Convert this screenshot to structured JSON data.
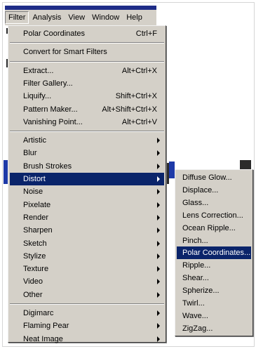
{
  "menubar": {
    "items": [
      "Filter",
      "Analysis",
      "View",
      "Window",
      "Help"
    ]
  },
  "filter_menu": {
    "groups": [
      [
        {
          "label": "Polar Coordinates",
          "shortcut": "Ctrl+F"
        }
      ],
      [
        {
          "label": "Convert for Smart Filters"
        }
      ],
      [
        {
          "label": "Extract...",
          "shortcut": "Alt+Ctrl+X"
        },
        {
          "label": "Filter Gallery..."
        },
        {
          "label": "Liquify...",
          "shortcut": "Shift+Ctrl+X"
        },
        {
          "label": "Pattern Maker...",
          "shortcut": "Alt+Shift+Ctrl+X"
        },
        {
          "label": "Vanishing Point...",
          "shortcut": "Alt+Ctrl+V"
        }
      ],
      [
        {
          "label": "Artistic",
          "submenu": true
        },
        {
          "label": "Blur",
          "submenu": true
        },
        {
          "label": "Brush Strokes",
          "submenu": true
        },
        {
          "label": "Distort",
          "submenu": true,
          "selected": true
        },
        {
          "label": "Noise",
          "submenu": true
        },
        {
          "label": "Pixelate",
          "submenu": true
        },
        {
          "label": "Render",
          "submenu": true
        },
        {
          "label": "Sharpen",
          "submenu": true
        },
        {
          "label": "Sketch",
          "submenu": true
        },
        {
          "label": "Stylize",
          "submenu": true
        },
        {
          "label": "Texture",
          "submenu": true
        },
        {
          "label": "Video",
          "submenu": true
        },
        {
          "label": "Other",
          "submenu": true
        }
      ],
      [
        {
          "label": "Digimarc",
          "submenu": true
        },
        {
          "label": "Flaming Pear",
          "submenu": true
        },
        {
          "label": "Neat Image",
          "submenu": true
        }
      ]
    ]
  },
  "distort_submenu": {
    "items": [
      {
        "label": "Diffuse Glow..."
      },
      {
        "label": "Displace..."
      },
      {
        "label": "Glass..."
      },
      {
        "label": "Lens Correction..."
      },
      {
        "label": "Ocean Ripple..."
      },
      {
        "label": "Pinch..."
      },
      {
        "label": "Polar Coordinates...",
        "selected": true
      },
      {
        "label": "Ripple..."
      },
      {
        "label": "Shear..."
      },
      {
        "label": "Spherize..."
      },
      {
        "label": "Twirl..."
      },
      {
        "label": "Wave..."
      },
      {
        "label": "ZigZag..."
      }
    ]
  },
  "colors": {
    "menu_bg": "#d4d0c8",
    "highlight": "#0a246a",
    "highlight_text": "#ffffff"
  }
}
